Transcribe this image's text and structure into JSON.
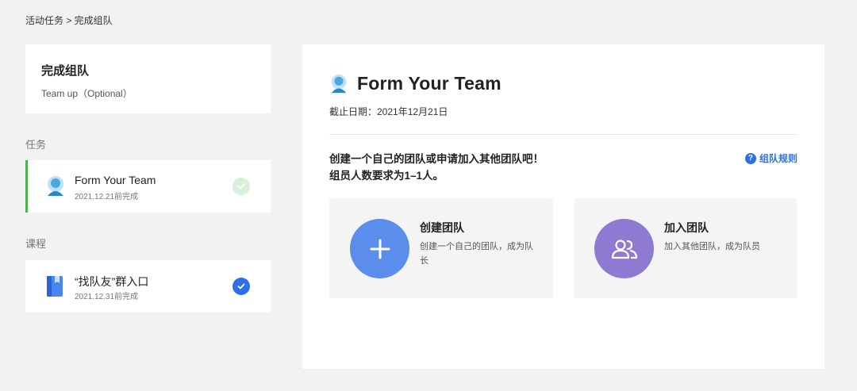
{
  "breadcrumb": {
    "text": "活动任务 > 完成组队"
  },
  "sidebar": {
    "header": {
      "title": "完成组队",
      "subtitle": "Team up（Optional）"
    },
    "tasks_label": "任务",
    "task": {
      "name": "Form Your Team",
      "date": "2021.12.21前完成",
      "status": "pending"
    },
    "course_label": "课程",
    "course": {
      "name": "“找队友”群入口",
      "date": "2021.12.31前完成",
      "status": "done"
    }
  },
  "main": {
    "title": "Form Your Team",
    "deadline": "截止日期：2021年12月21日",
    "desc_line1": "创建一个自己的团队或申请加入其他团队吧！",
    "desc_line2": "组员人数要求为1–1人。",
    "rules_label": "组队规则",
    "options": [
      {
        "title": "创建团队",
        "desc": "创建一个自己的团队，成为队长",
        "icon": "plus-icon",
        "color": "#5b8dec"
      },
      {
        "title": "加入团队",
        "desc": "加入其他团队，成为队员",
        "icon": "users-icon",
        "color": "#8e7ad3"
      }
    ]
  },
  "colors": {
    "accent_green": "#4cb14a",
    "primary_blue": "#2f6fe8"
  }
}
